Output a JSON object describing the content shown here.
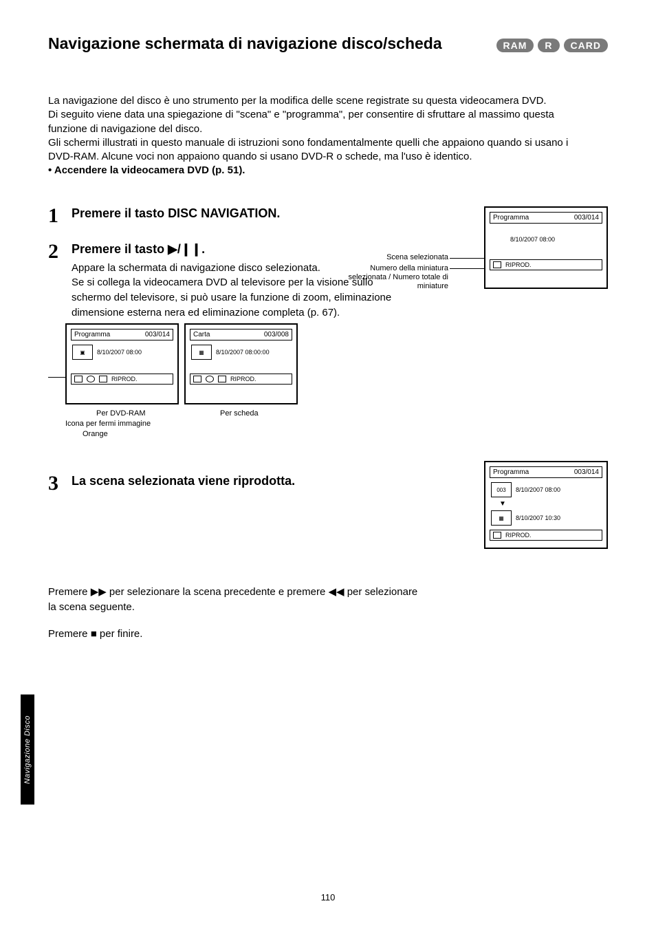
{
  "header": "Navigazione schermata di navigazione disco/scheda",
  "badges": [
    "RAM",
    "R",
    "CARD"
  ],
  "intro_prefix": "La navigazione del disco è uno strumento per la modifica delle scene registrate su questa videocamera DVD. \n Di seguito viene data una spiegazione di \"scena\" e \"programma\", per consentire di sfruttare al massimo questa funzione di navigazione del disco.\n Gli schermi illustrati in questo manuale di istruzioni sono fondamentalmente quelli che appaiono quando si usano i DVD-RAM. Alcune voci non appaiono quando si usano DVD-R o schede, ma l'uso è identico. \n",
  "intro_bold": "• Accendere la videocamera DVD (p. 51).",
  "steps": {
    "s1": {
      "num": "1",
      "main": "Premere il tasto DISC NAVIGATION.",
      "sub": ""
    },
    "s2": {
      "num": "2",
      "main_a": "Premere il tasto ",
      "main_b": "."
    },
    "s2_body": "Appare la schermata di navigazione disco selezionata. \n Se si collega la videocamera DVD al televisore per la visione sullo schermo del televisore, si può usare la funzione di zoom, eliminazione dimensione esterna nera ed eliminazione completa (p. 67).",
    "s3": {
      "num": "3",
      "main": "La scena selezionata viene riprodotta.",
      "sub": ""
    },
    "bottom_p1_a": "Premere ",
    "bottom_p1_b": " per selezionare la scena precedente e premere ",
    "bottom_p1_c": " per selezionare la scena seguente.",
    "bottom_p2_a": "Premere ",
    "bottom_p2_b": " per finire."
  },
  "screens": {
    "top": {
      "title_left": "Programma",
      "title_right": "003/014",
      "label1": "8/10/2007 08:00",
      "footer": "RIPROD.",
      "callout1": "Scena selezionata",
      "callout2": "Numero della miniatura selezionata / Numero totale di miniature"
    },
    "left": {
      "title_left": "Programma",
      "title_right": "003/014",
      "label1": "8/10/2007 08:00",
      "footer": "RIPROD.",
      "callout": "Icona per fermi immagine",
      "caption": "Per DVD-RAM",
      "caption2": "Orange"
    },
    "mid": {
      "title_left": "Carta",
      "title_right": "003/008",
      "label1": "8/10/2007 08:00:00",
      "footer": "RIPROD.",
      "caption": "Per scheda"
    },
    "right": {
      "title_left": "Programma",
      "title_right": "003/014",
      "thumb1": "003",
      "label1": "8/10/2007 08:00",
      "label2": "8/10/2007 10:30",
      "footer": "RIPROD."
    }
  },
  "sidebar": "Navigazione Disco",
  "page_number": "110"
}
